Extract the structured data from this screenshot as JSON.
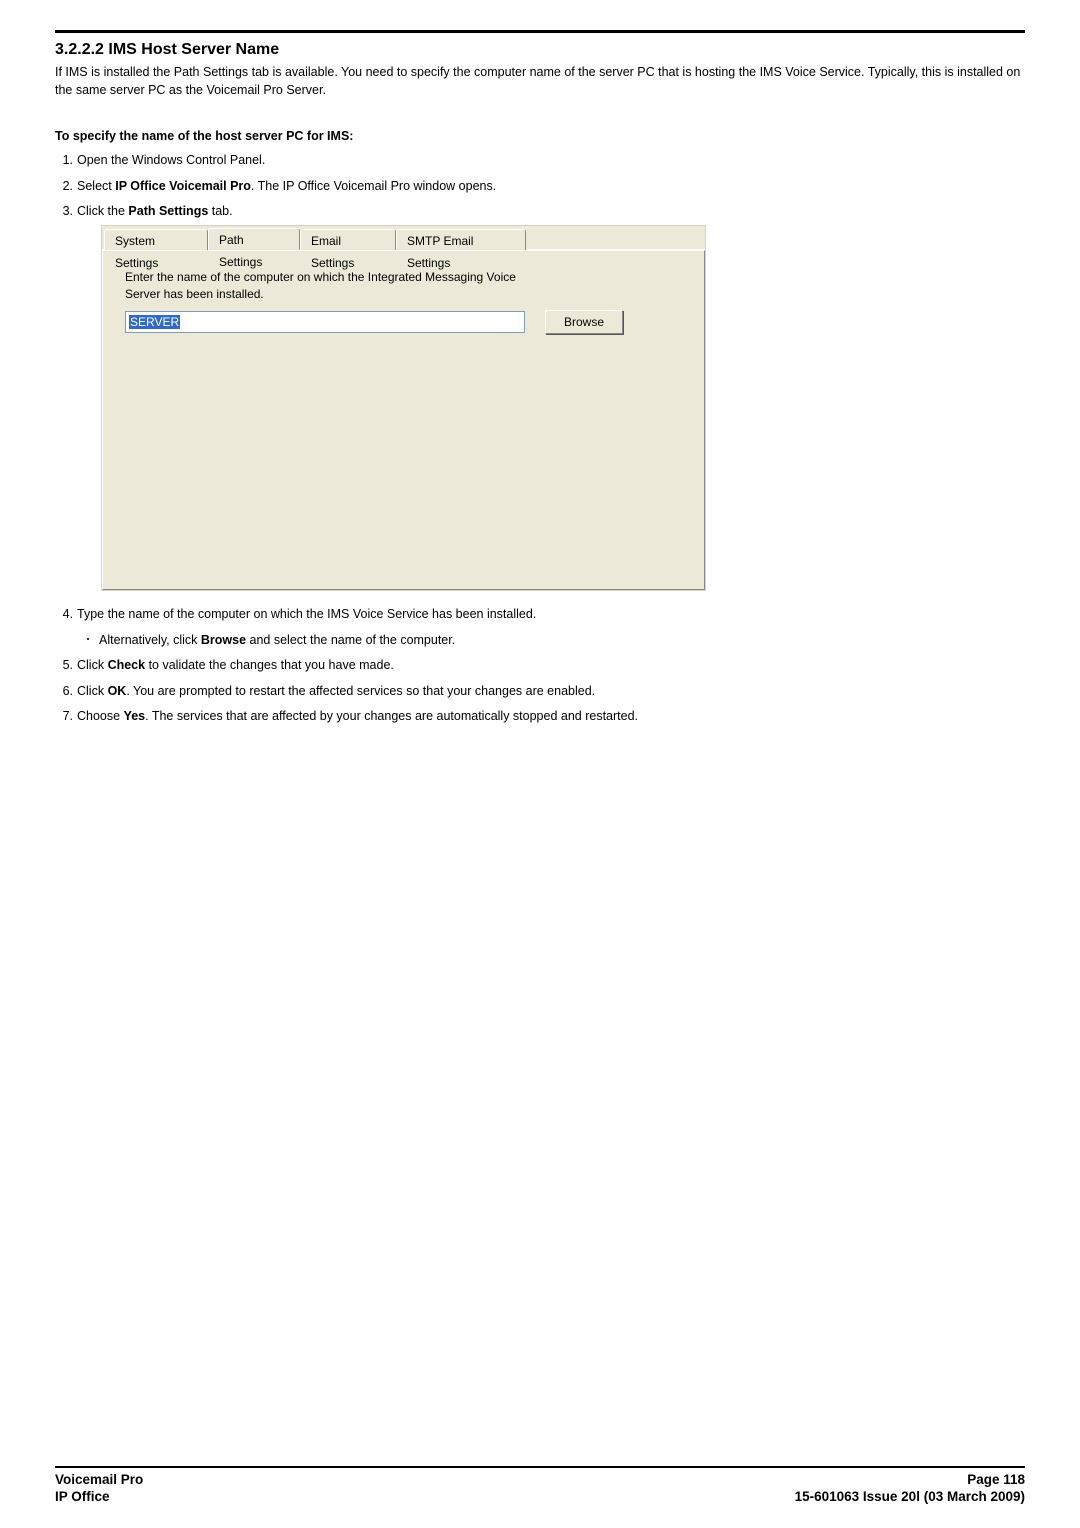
{
  "heading": "3.2.2.2 IMS Host Server Name",
  "intro": "If IMS is installed the Path Settings tab is available. You need to specify the computer name of the server PC that is hosting the IMS Voice Service. Typically, this is installed on the same server PC as the Voicemail Pro Server.",
  "subhead": "To specify the name of the host server PC for IMS:",
  "steps": {
    "s1": {
      "num": "1.",
      "text": "Open the Windows Control Panel."
    },
    "s2": {
      "num": "2.",
      "prefix": "Select ",
      "bold": "IP Office Voicemail Pro",
      "suffix": ". The IP Office Voicemail Pro window opens."
    },
    "s3": {
      "num": "3.",
      "prefix": "Click the ",
      "bold": "Path Settings",
      "suffix": " tab."
    },
    "s4": {
      "num": "4.",
      "text": "Type the name of the computer on which the IMS Voice Service has been installed."
    },
    "s4a": {
      "prefix": "Alternatively, click ",
      "bold": "Browse",
      "suffix": " and select the name of the computer."
    },
    "s5": {
      "num": "5.",
      "prefix": "Click ",
      "bold": "Check",
      "suffix": " to validate the changes that you have made."
    },
    "s6": {
      "num": "6.",
      "prefix": "Click ",
      "bold": "OK",
      "suffix": ". You are prompted to restart the affected services so that your changes are enabled."
    },
    "s7": {
      "num": "7.",
      "prefix": "Choose ",
      "bold": "Yes",
      "suffix": ". The services that are affected by your changes are automatically stopped and restarted."
    }
  },
  "dialog": {
    "tabs": {
      "system": "System Settings",
      "path": "Path Settings",
      "email": "Email Settings",
      "smtp": "SMTP Email Settings"
    },
    "panel_label_line1": "Enter the name of the computer on which the Integrated Messaging Voice",
    "panel_label_line2": "Server has been installed.",
    "server_value": "SERVER",
    "browse": "Browse"
  },
  "footer": {
    "left1": "Voicemail Pro",
    "left2": "IP Office",
    "right1": "Page 118",
    "right2": "15-601063 Issue 20l (03 March 2009)"
  }
}
